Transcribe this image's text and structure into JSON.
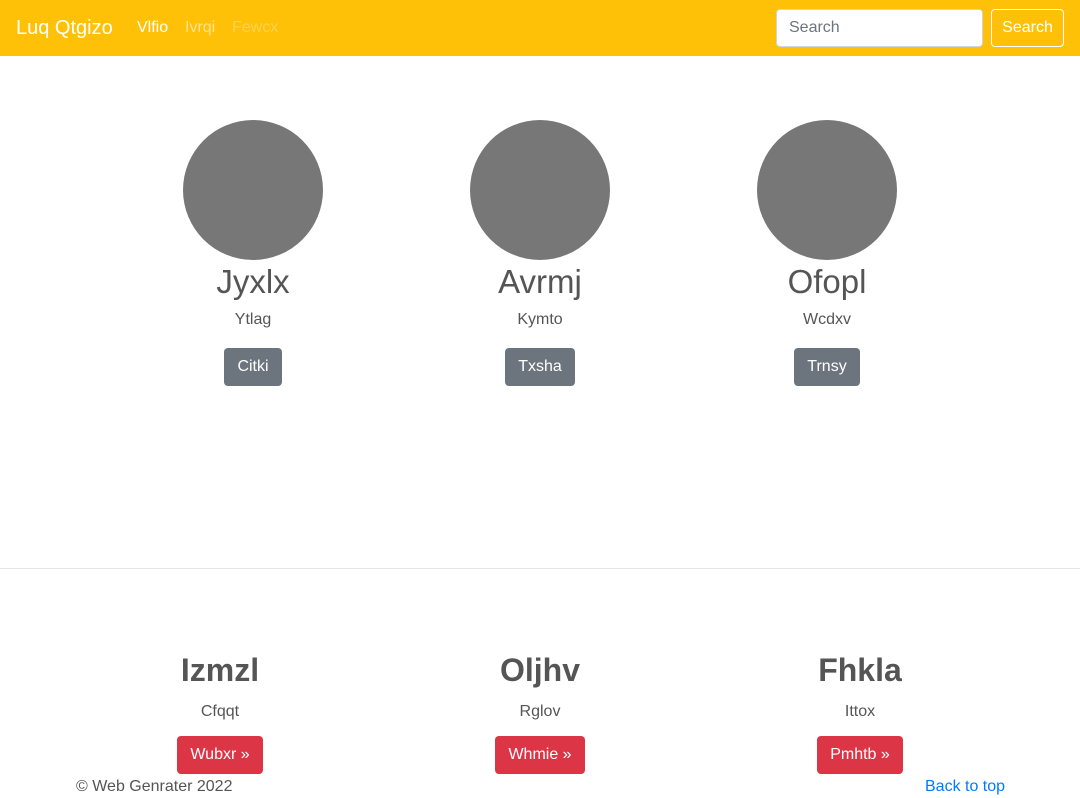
{
  "navbar": {
    "brand": "Luq Qtgizo",
    "links": [
      "Vlfio",
      "Ivrqi",
      "Fewcx"
    ],
    "search_placeholder": "Search",
    "search_button": "Search",
    "background_color": "#ffc107"
  },
  "profiles": [
    {
      "name": "Jyxlx",
      "subtitle": "Ytlag",
      "button": "Citki"
    },
    {
      "name": "Avrmj",
      "subtitle": "Kymto",
      "button": "Txsha"
    },
    {
      "name": "Ofopl",
      "subtitle": "Wcdxv",
      "button": "Trnsy"
    }
  ],
  "features": [
    {
      "title": "Izmzl",
      "subtitle": "Cfqqt",
      "button": "Wubxr »"
    },
    {
      "title": "Oljhv",
      "subtitle": "Rglov",
      "button": "Whmie »"
    },
    {
      "title": "Fhkla",
      "subtitle": "Ittox",
      "button": "Pmhtb »"
    }
  ],
  "footer": {
    "copyright": "© Web Genrater 2022",
    "back_to_top": "Back to top"
  }
}
